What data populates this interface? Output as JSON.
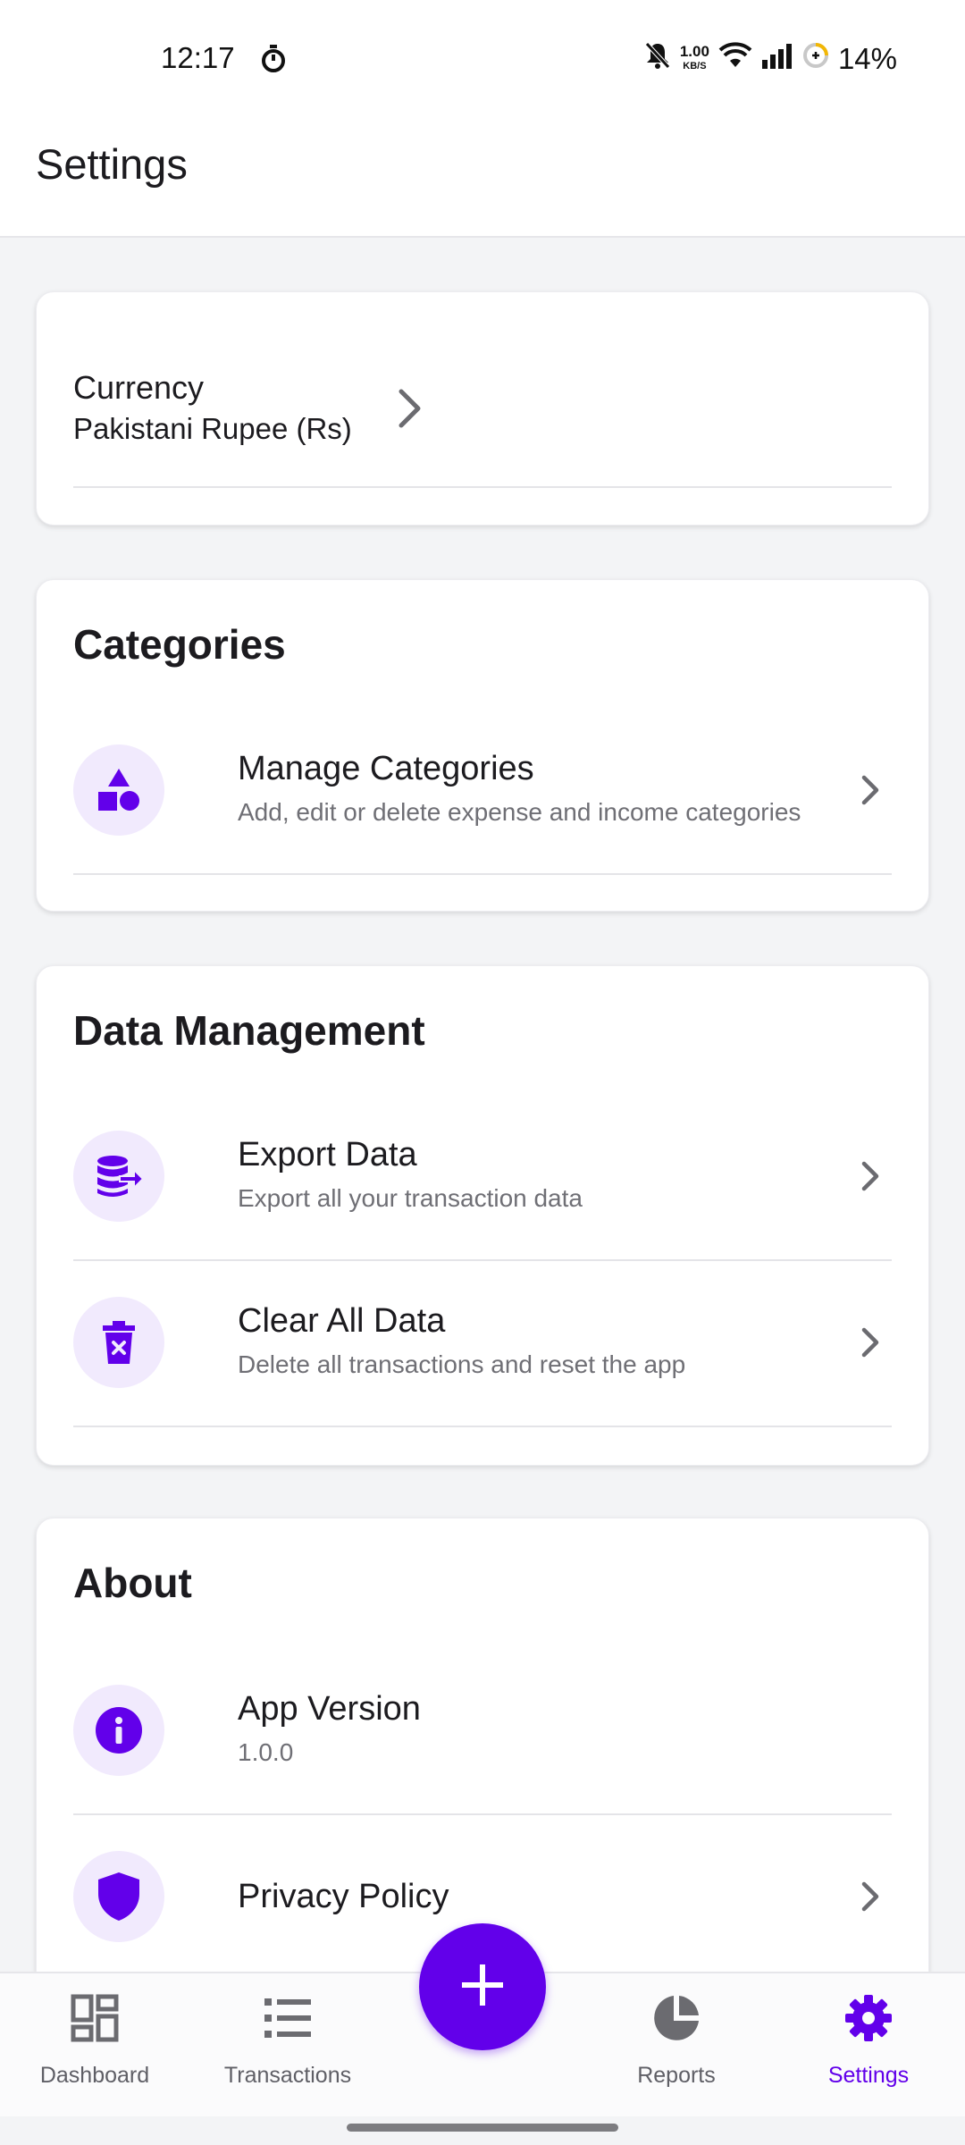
{
  "status_bar": {
    "time": "12:17",
    "net_speed_value": "1.00",
    "net_speed_unit": "KB/S",
    "battery": "14%"
  },
  "header": {
    "title": "Settings"
  },
  "currency": {
    "label": "Currency",
    "value": "Pakistani Rupee (Rs)"
  },
  "categories": {
    "title": "Categories",
    "items": [
      {
        "title": "Manage Categories",
        "subtitle": "Add, edit or delete expense and income categories",
        "icon": "shapes-icon"
      }
    ]
  },
  "data_management": {
    "title": "Data Management",
    "items": [
      {
        "title": "Export Data",
        "subtitle": "Export all your transaction data",
        "icon": "database-export-icon"
      },
      {
        "title": "Clear All Data",
        "subtitle": "Delete all transactions and reset the app",
        "icon": "trash-icon"
      }
    ]
  },
  "about": {
    "title": "About",
    "items": [
      {
        "title": "App Version",
        "subtitle": "1.0.0",
        "icon": "info-icon"
      },
      {
        "title": "Privacy Policy",
        "icon": "shield-icon"
      }
    ]
  },
  "bottom_nav": {
    "items": [
      {
        "label": "Dashboard",
        "icon": "dashboard-icon"
      },
      {
        "label": "Transactions",
        "icon": "list-icon"
      },
      {
        "label": "Reports",
        "icon": "pie-chart-icon"
      },
      {
        "label": "Settings",
        "icon": "gear-icon",
        "active": true
      }
    ],
    "fab_icon": "plus-icon"
  },
  "colors": {
    "accent": "#6200ea",
    "icon_bg": "#f1eafd",
    "background": "#f3f4f6"
  }
}
